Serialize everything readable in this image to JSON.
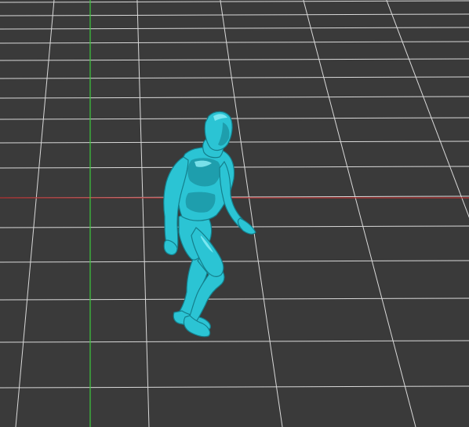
{
  "viewport": {
    "kind": "3d-perspective-view",
    "background_color": "#3a3a3a",
    "grid": {
      "visible": true,
      "line_color": "#d9d9d9"
    },
    "axes": {
      "x_axis_color": "#b23030",
      "y_axis_color": "#3cc83c"
    },
    "model": {
      "name": "humanoid-figure",
      "pose": "walking",
      "color": "#2bc4d4",
      "shadow_color": "#147f8c",
      "highlight_color": "#8ef0f8"
    }
  }
}
